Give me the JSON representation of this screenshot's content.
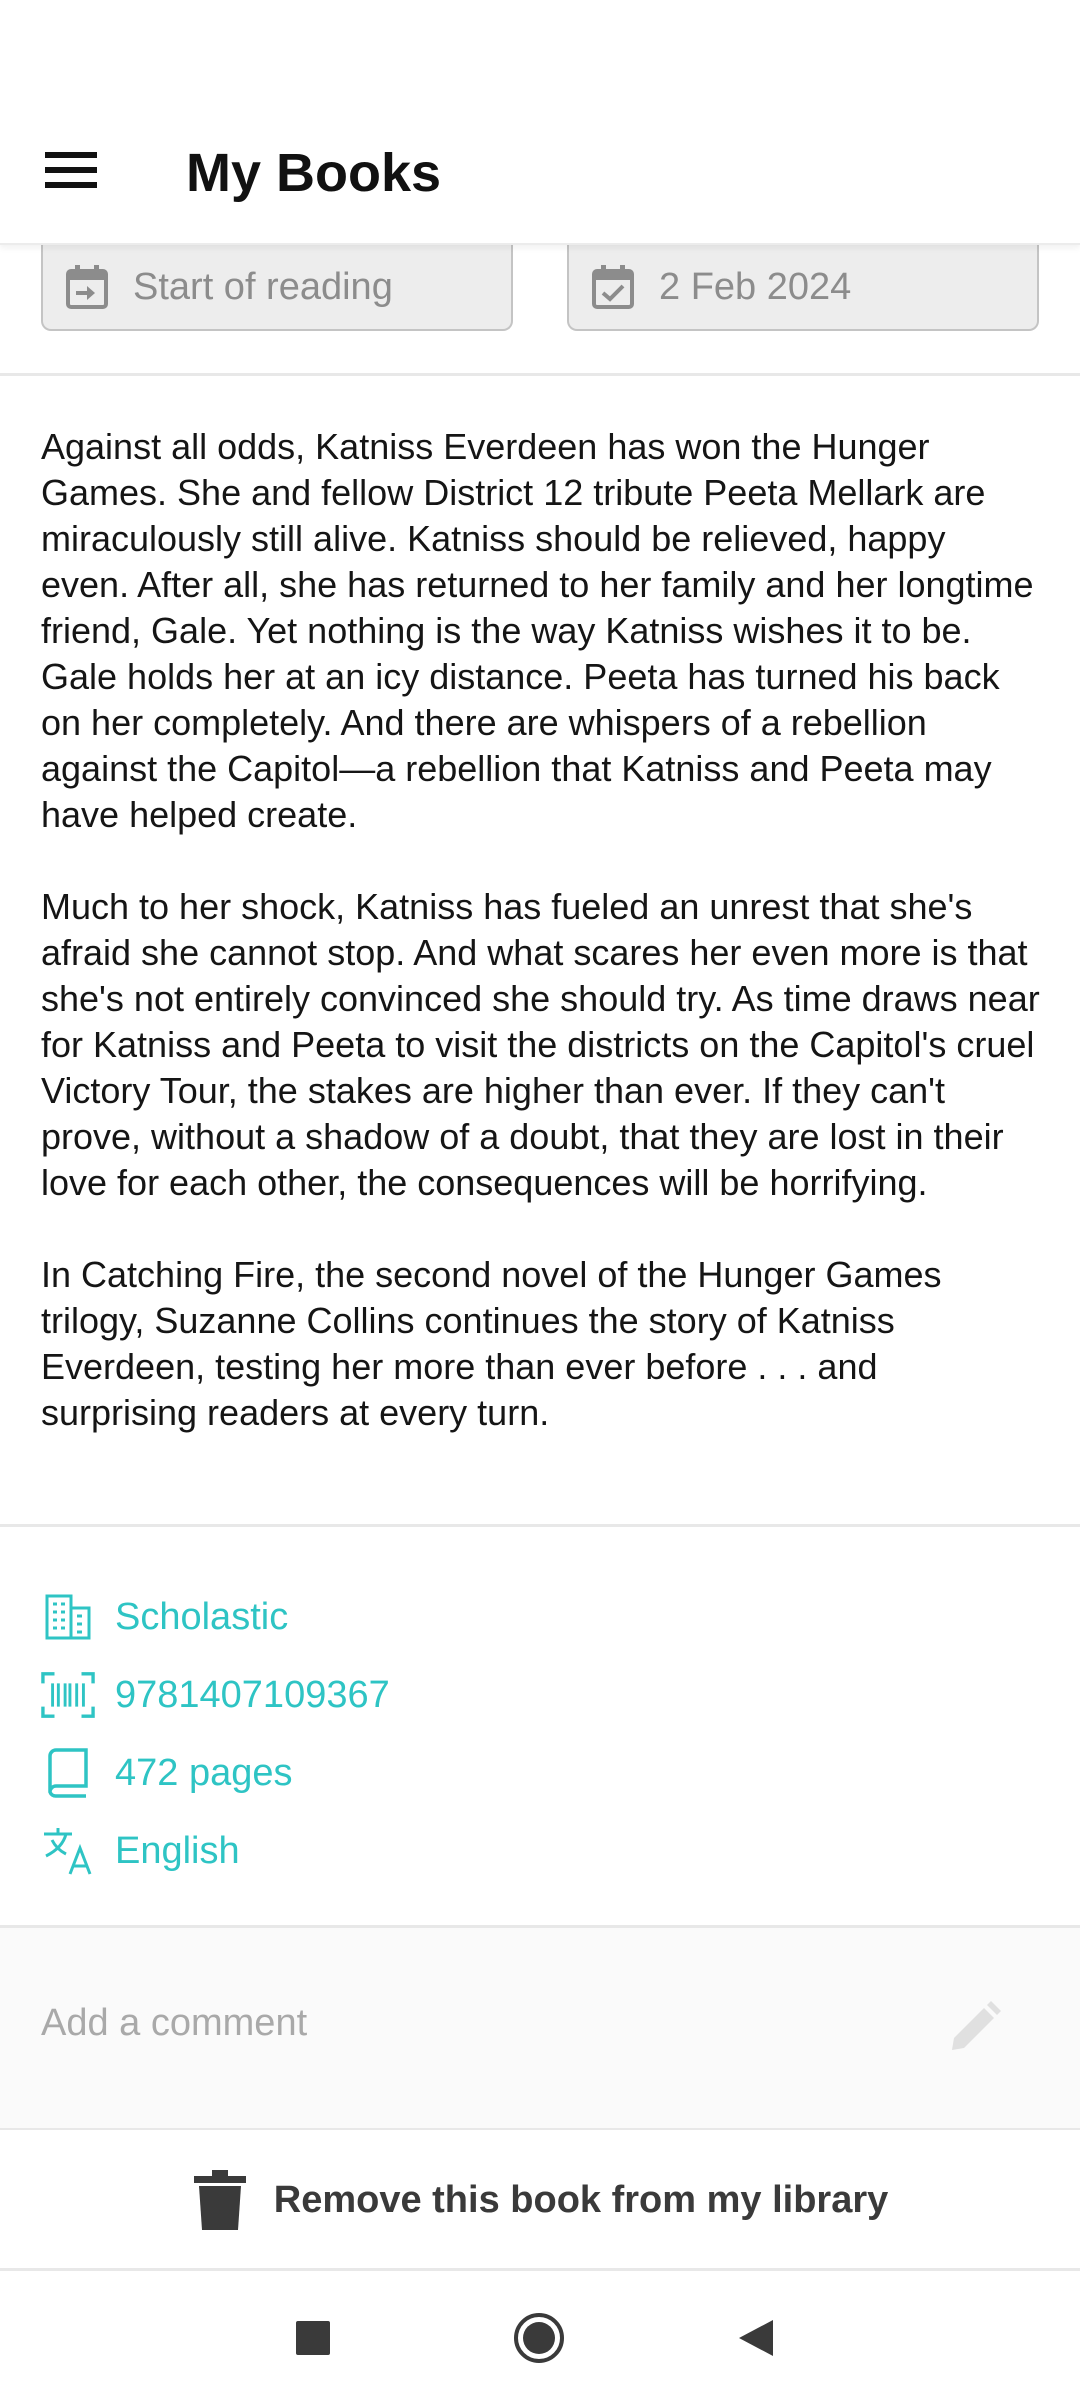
{
  "app_bar": {
    "title": "My Books",
    "menu_icon": "hamburger-menu-icon"
  },
  "dates": {
    "start": {
      "placeholder": "Start of reading",
      "icon": "calendar-start-icon"
    },
    "end": {
      "value": "2 Feb 2024",
      "icon": "calendar-check-icon"
    }
  },
  "description": {
    "paragraphs": [
      "Against all odds, Katniss Everdeen has won the Hunger Games. She and fellow District 12 tribute Peeta Mellark are miraculously still alive. Katniss should be relieved, happy even. After all, she has returned to her family and her longtime friend, Gale. Yet nothing is the way Katniss wishes it to be. Gale holds her at an icy distance. Peeta has turned his back on her completely. And there are whispers of a rebellion against the Capitol—a rebellion that Katniss and Peeta may have helped create.",
      "Much to her shock, Katniss has fueled an unrest that she's afraid she cannot stop. And what scares her even more is that she's not entirely convinced she should try. As time draws near for Katniss and Peeta to visit the districts on the Capitol's cruel Victory Tour, the stakes are higher than ever. If they can't prove, without a shadow of a doubt, that they are lost in their love for each other, the consequences will be horrifying.",
      "In Catching Fire, the second novel of the Hunger Games trilogy, Suzanne Collins continues the story of Katniss Everdeen, testing her more than ever before . . . and surprising readers at every turn."
    ]
  },
  "details": {
    "publisher": "Scholastic",
    "isbn": "9781407109367",
    "pages": "472 pages",
    "language": "English"
  },
  "comment": {
    "placeholder": "Add a comment",
    "icon": "pencil-icon"
  },
  "actions": {
    "remove_label": "Remove this book from my library",
    "remove_icon": "trash-icon"
  },
  "navigation": {
    "recents_icon": "square-recents-icon",
    "home_icon": "circle-home-icon",
    "back_icon": "triangle-back-icon"
  },
  "colors": {
    "accent": "#2ec4c4",
    "text": "#151515",
    "muted": "#8c8c8c"
  }
}
